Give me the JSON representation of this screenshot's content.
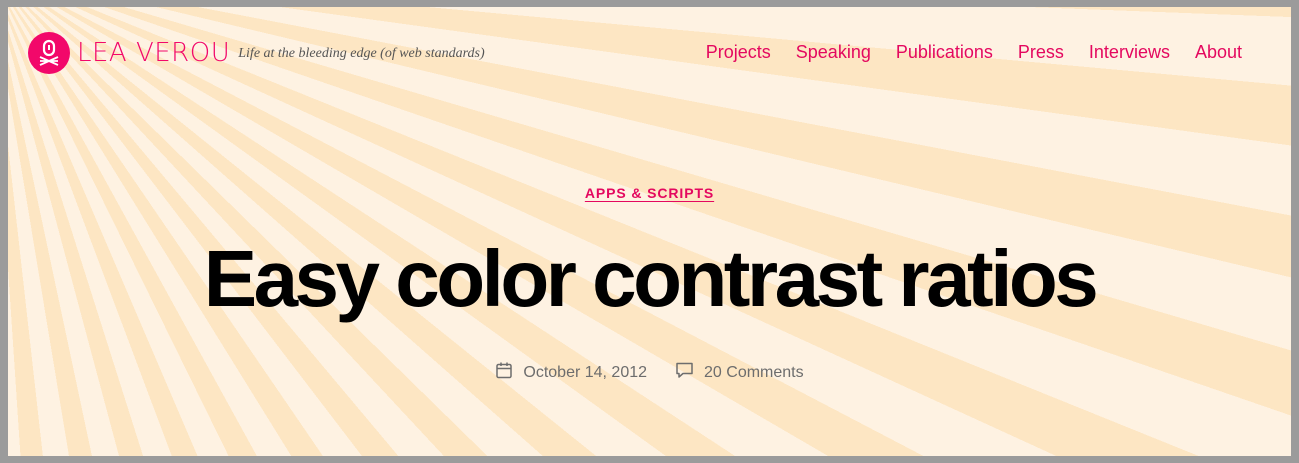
{
  "site": {
    "title": "LEA VEROU",
    "tagline": "Life at the bleeding edge (of web standards)",
    "brand_color": "#f2086a",
    "logo_icon": "logo-icon"
  },
  "nav": {
    "items": [
      {
        "label": "Projects"
      },
      {
        "label": "Speaking"
      },
      {
        "label": "Publications"
      },
      {
        "label": "Press"
      },
      {
        "label": "Interviews"
      },
      {
        "label": "About"
      }
    ]
  },
  "post": {
    "category": "APPS & SCRIPTS",
    "title": "Easy color contrast ratios",
    "date": "October 14, 2012",
    "comments": "20 Comments",
    "date_icon": "calendar-icon",
    "comments_icon": "comment-icon"
  }
}
